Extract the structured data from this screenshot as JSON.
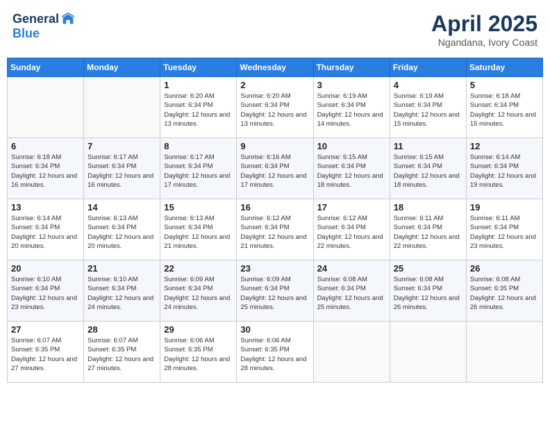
{
  "header": {
    "logo_general": "General",
    "logo_blue": "Blue",
    "month_year": "April 2025",
    "location": "Ngandana, Ivory Coast"
  },
  "weekdays": [
    "Sunday",
    "Monday",
    "Tuesday",
    "Wednesday",
    "Thursday",
    "Friday",
    "Saturday"
  ],
  "weeks": [
    [
      {
        "day": "",
        "detail": ""
      },
      {
        "day": "",
        "detail": ""
      },
      {
        "day": "1",
        "detail": "Sunrise: 6:20 AM\nSunset: 6:34 PM\nDaylight: 12 hours and 13 minutes."
      },
      {
        "day": "2",
        "detail": "Sunrise: 6:20 AM\nSunset: 6:34 PM\nDaylight: 12 hours and 13 minutes."
      },
      {
        "day": "3",
        "detail": "Sunrise: 6:19 AM\nSunset: 6:34 PM\nDaylight: 12 hours and 14 minutes."
      },
      {
        "day": "4",
        "detail": "Sunrise: 6:19 AM\nSunset: 6:34 PM\nDaylight: 12 hours and 15 minutes."
      },
      {
        "day": "5",
        "detail": "Sunrise: 6:18 AM\nSunset: 6:34 PM\nDaylight: 12 hours and 15 minutes."
      }
    ],
    [
      {
        "day": "6",
        "detail": "Sunrise: 6:18 AM\nSunset: 6:34 PM\nDaylight: 12 hours and 16 minutes."
      },
      {
        "day": "7",
        "detail": "Sunrise: 6:17 AM\nSunset: 6:34 PM\nDaylight: 12 hours and 16 minutes."
      },
      {
        "day": "8",
        "detail": "Sunrise: 6:17 AM\nSunset: 6:34 PM\nDaylight: 12 hours and 17 minutes."
      },
      {
        "day": "9",
        "detail": "Sunrise: 6:16 AM\nSunset: 6:34 PM\nDaylight: 12 hours and 17 minutes."
      },
      {
        "day": "10",
        "detail": "Sunrise: 6:15 AM\nSunset: 6:34 PM\nDaylight: 12 hours and 18 minutes."
      },
      {
        "day": "11",
        "detail": "Sunrise: 6:15 AM\nSunset: 6:34 PM\nDaylight: 12 hours and 18 minutes."
      },
      {
        "day": "12",
        "detail": "Sunrise: 6:14 AM\nSunset: 6:34 PM\nDaylight: 12 hours and 19 minutes."
      }
    ],
    [
      {
        "day": "13",
        "detail": "Sunrise: 6:14 AM\nSunset: 6:34 PM\nDaylight: 12 hours and 20 minutes."
      },
      {
        "day": "14",
        "detail": "Sunrise: 6:13 AM\nSunset: 6:34 PM\nDaylight: 12 hours and 20 minutes."
      },
      {
        "day": "15",
        "detail": "Sunrise: 6:13 AM\nSunset: 6:34 PM\nDaylight: 12 hours and 21 minutes."
      },
      {
        "day": "16",
        "detail": "Sunrise: 6:12 AM\nSunset: 6:34 PM\nDaylight: 12 hours and 21 minutes."
      },
      {
        "day": "17",
        "detail": "Sunrise: 6:12 AM\nSunset: 6:34 PM\nDaylight: 12 hours and 22 minutes."
      },
      {
        "day": "18",
        "detail": "Sunrise: 6:11 AM\nSunset: 6:34 PM\nDaylight: 12 hours and 22 minutes."
      },
      {
        "day": "19",
        "detail": "Sunrise: 6:11 AM\nSunset: 6:34 PM\nDaylight: 12 hours and 23 minutes."
      }
    ],
    [
      {
        "day": "20",
        "detail": "Sunrise: 6:10 AM\nSunset: 6:34 PM\nDaylight: 12 hours and 23 minutes."
      },
      {
        "day": "21",
        "detail": "Sunrise: 6:10 AM\nSunset: 6:34 PM\nDaylight: 12 hours and 24 minutes."
      },
      {
        "day": "22",
        "detail": "Sunrise: 6:09 AM\nSunset: 6:34 PM\nDaylight: 12 hours and 24 minutes."
      },
      {
        "day": "23",
        "detail": "Sunrise: 6:09 AM\nSunset: 6:34 PM\nDaylight: 12 hours and 25 minutes."
      },
      {
        "day": "24",
        "detail": "Sunrise: 6:08 AM\nSunset: 6:34 PM\nDaylight: 12 hours and 25 minutes."
      },
      {
        "day": "25",
        "detail": "Sunrise: 6:08 AM\nSunset: 6:34 PM\nDaylight: 12 hours and 26 minutes."
      },
      {
        "day": "26",
        "detail": "Sunrise: 6:08 AM\nSunset: 6:35 PM\nDaylight: 12 hours and 26 minutes."
      }
    ],
    [
      {
        "day": "27",
        "detail": "Sunrise: 6:07 AM\nSunset: 6:35 PM\nDaylight: 12 hours and 27 minutes."
      },
      {
        "day": "28",
        "detail": "Sunrise: 6:07 AM\nSunset: 6:35 PM\nDaylight: 12 hours and 27 minutes."
      },
      {
        "day": "29",
        "detail": "Sunrise: 6:06 AM\nSunset: 6:35 PM\nDaylight: 12 hours and 28 minutes."
      },
      {
        "day": "30",
        "detail": "Sunrise: 6:06 AM\nSunset: 6:35 PM\nDaylight: 12 hours and 28 minutes."
      },
      {
        "day": "",
        "detail": ""
      },
      {
        "day": "",
        "detail": ""
      },
      {
        "day": "",
        "detail": ""
      }
    ]
  ]
}
